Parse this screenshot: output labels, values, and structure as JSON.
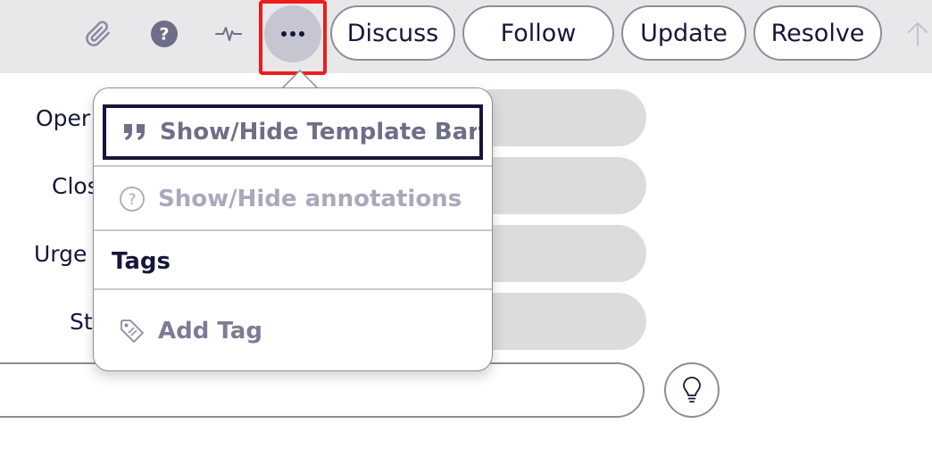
{
  "toolbar": {
    "icons": [
      "paperclip-icon",
      "help-circle-icon",
      "activity-pulse-icon",
      "more-options-icon"
    ],
    "buttons": {
      "discuss": "Discuss",
      "follow": "Follow",
      "update": "Update",
      "resolve": "Resolve"
    }
  },
  "form": {
    "labels": [
      "Oper",
      "Clos",
      "Urge",
      "St"
    ]
  },
  "menu": {
    "show_hide_template_bar": "Show/Hide Template Bar",
    "show_hide_annotations": "Show/Hide annotations",
    "tags_heading": "Tags",
    "add_tag": "Add Tag"
  },
  "colors": {
    "toolbar_bg": "#e8e8ea",
    "icon_gray": "#8a8aa0",
    "text_dark": "#16163a",
    "highlight_red": "#ee1c1c",
    "disabled_text": "#a9a9bc",
    "field_bg": "#dcdcde"
  }
}
